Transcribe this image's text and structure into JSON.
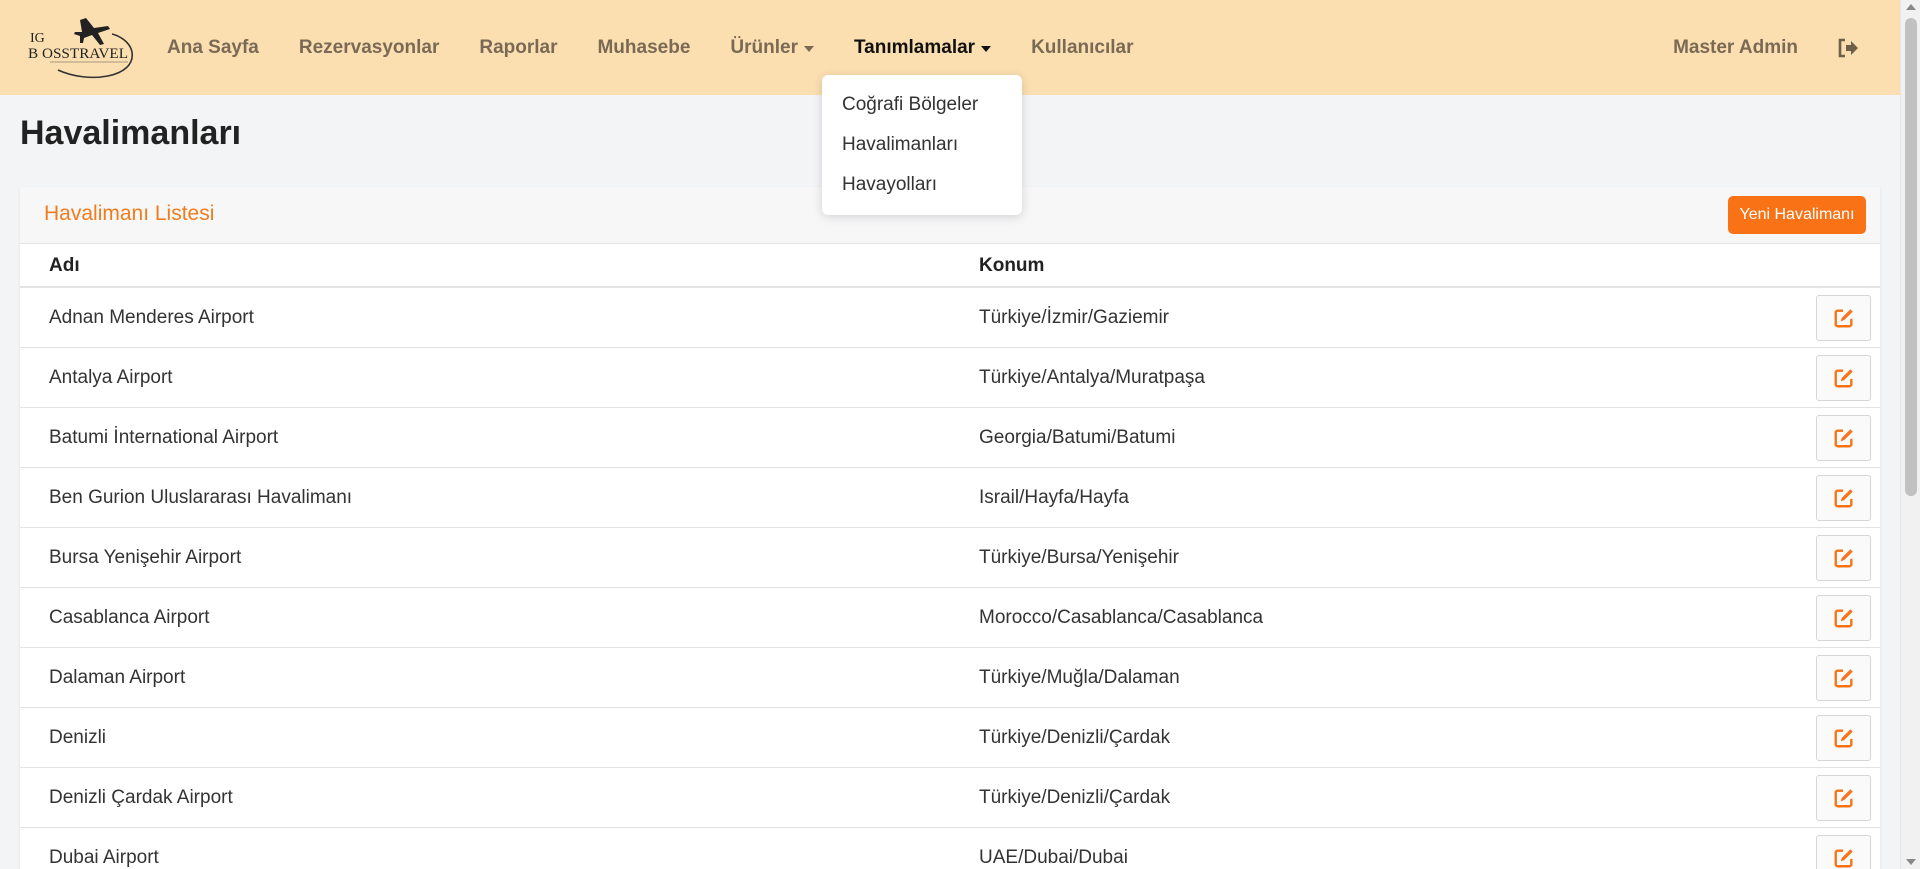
{
  "brand": {
    "logo_text_top": "IG",
    "logo_text_main": "B OSSTRAVEL",
    "logo_icon": "airplane-logo-icon"
  },
  "nav": {
    "items": [
      {
        "label": "Ana Sayfa",
        "has_caret": false,
        "active": false
      },
      {
        "label": "Rezervasyonlar",
        "has_caret": false,
        "active": false
      },
      {
        "label": "Raporlar",
        "has_caret": false,
        "active": false
      },
      {
        "label": "Muhasebe",
        "has_caret": false,
        "active": false
      },
      {
        "label": "Ürünler",
        "has_caret": true,
        "active": false
      },
      {
        "label": "Tanımlamalar",
        "has_caret": true,
        "active": true
      },
      {
        "label": "Kullanıcılar",
        "has_caret": false,
        "active": false
      }
    ],
    "user_name": "Master Admin",
    "logout_icon": "sign-out-icon"
  },
  "dropdown": {
    "items": [
      "Coğrafi Bölgeler",
      "Havalimanları",
      "Havayolları"
    ]
  },
  "page": {
    "title": "Havalimanları"
  },
  "card": {
    "title": "Havalimanı Listesi",
    "new_button_label": "Yeni Havalimanı",
    "columns": {
      "name": "Adı",
      "location": "Konum"
    },
    "rows": [
      {
        "name": "Adnan Menderes Airport",
        "location": "Türkiye/İzmir/Gaziemir"
      },
      {
        "name": "Antalya Airport",
        "location": "Türkiye/Antalya/Muratpaşa"
      },
      {
        "name": "Batumi İnternational Airport",
        "location": "Georgia/Batumi/Batumi"
      },
      {
        "name": "Ben Gurion Uluslararası Havalimanı",
        "location": "Israil/Hayfa/Hayfa"
      },
      {
        "name": "Bursa Yenişehir Airport",
        "location": "Türkiye/Bursa/Yenişehir"
      },
      {
        "name": "Casablanca Airport",
        "location": "Morocco/Casablanca/Casablanca"
      },
      {
        "name": "Dalaman Airport",
        "location": "Türkiye/Muğla/Dalaman"
      },
      {
        "name": "Denizli",
        "location": "Türkiye/Denizli/Çardak"
      },
      {
        "name": "Denizli Çardak Airport",
        "location": "Türkiye/Denizli/Çardak"
      },
      {
        "name": "Dubai Airport",
        "location": "UAE/Dubai/Dubai"
      }
    ],
    "edit_icon": "edit-icon"
  },
  "colors": {
    "navbar_bg": "#fbdfb0",
    "accent": "#f97316",
    "nav_text": "#7a6a55"
  }
}
